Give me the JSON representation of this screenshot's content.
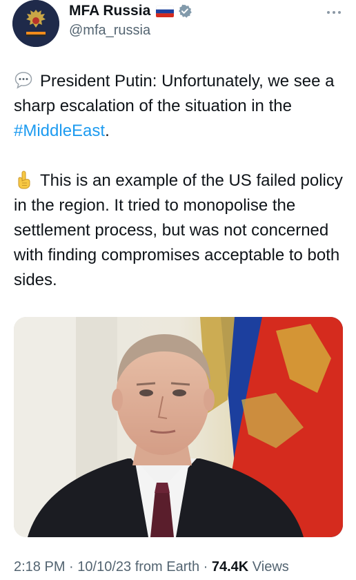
{
  "account": {
    "display_name": "MFA Russia",
    "handle": "@mfa_russia",
    "flag_icon": "russia-flag-icon",
    "badge_icon": "government-badge-icon",
    "badge_color": "#829aab"
  },
  "tweet": {
    "paragraph1": {
      "emoji_icon": "speech-bubble-icon",
      "text_before": "President Putin: Unfortunately, we see a sharp escalation of the situation in the ",
      "hashtag": "#MiddleEast",
      "text_after": "."
    },
    "paragraph2": {
      "emoji_icon": "pointing-up-hand-icon",
      "text": "This is an example of the US failed policy in the region. It tried to monopolise the settlement process, but was not concerned with finding compromises acceptable to both sides."
    }
  },
  "media": {
    "image_icon": "photo-image",
    "flag_colors": [
      "#ffffff",
      "#1c3f9e",
      "#d52b1e"
    ]
  },
  "meta": {
    "time": "2:18 PM",
    "date": "10/10/23",
    "source": "from Earth",
    "separator": "·",
    "views_count": "74.4K",
    "views_label": "Views"
  },
  "colors": {
    "hashtag": "#1d9bf0",
    "secondary_text": "#536471",
    "primary_text": "#0f1419"
  }
}
